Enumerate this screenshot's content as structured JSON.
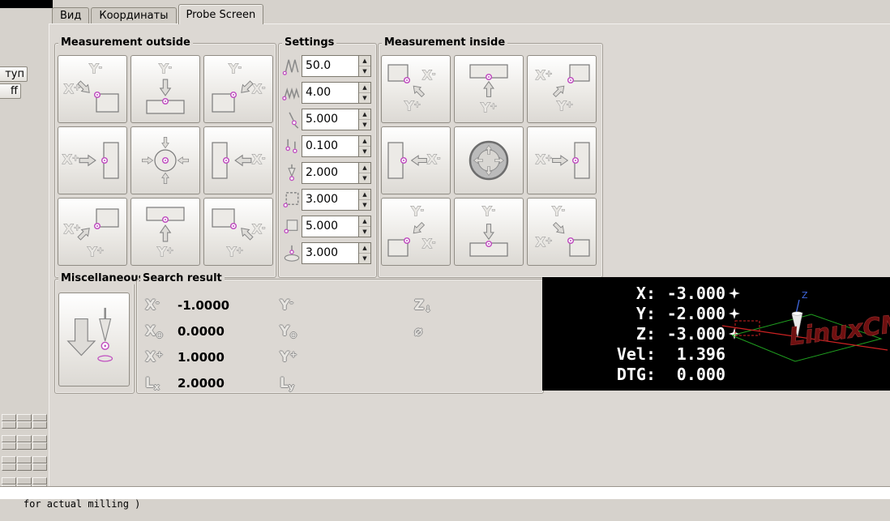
{
  "tabs": {
    "items": [
      {
        "label": "Вид"
      },
      {
        "label": "Координаты"
      },
      {
        "label": "Probe Screen"
      }
    ],
    "active_index": 2
  },
  "sidebar": {
    "top_button": "туп",
    "off_button": "ff"
  },
  "outside": {
    "title": "Measurement outside",
    "buttons": [
      {
        "icon": "out-corner-se",
        "labels": {
          "top": "Y-",
          "left": "X+"
        }
      },
      {
        "icon": "out-edge-s",
        "labels": {
          "top": "Y-"
        }
      },
      {
        "icon": "out-corner-sw",
        "labels": {
          "top": "Y-",
          "right": "X-"
        }
      },
      {
        "icon": "out-edge-e",
        "labels": {
          "left": "X+"
        }
      },
      {
        "icon": "out-center",
        "labels": {}
      },
      {
        "icon": "out-edge-w",
        "labels": {
          "right": "X-"
        }
      },
      {
        "icon": "out-corner-ne",
        "labels": {
          "left": "X+",
          "bottom": "Y+"
        }
      },
      {
        "icon": "out-edge-n",
        "labels": {
          "bottom": "Y+"
        }
      },
      {
        "icon": "out-corner-nw",
        "labels": {
          "right": "X-",
          "bottom": "Y+"
        }
      }
    ]
  },
  "settings": {
    "title": "Settings",
    "fields": [
      {
        "icon": "zigzag-fast-icon",
        "value": "50.0"
      },
      {
        "icon": "zigzag-slow-icon",
        "value": "4.00"
      },
      {
        "icon": "probe-tilt-icon",
        "value": "5.000"
      },
      {
        "icon": "probe-pair-icon",
        "value": "0.100"
      },
      {
        "icon": "probe-upright-icon",
        "value": "2.000"
      },
      {
        "icon": "square-dashed-icon",
        "value": "3.000"
      },
      {
        "icon": "square-solid-icon",
        "value": "5.000"
      },
      {
        "icon": "probe-cylinder-icon",
        "value": "3.000"
      }
    ]
  },
  "inside": {
    "title": "Measurement inside",
    "buttons": [
      {
        "icon": "in-corner-nw",
        "labels": {
          "right": "X-",
          "bottom": "Y+"
        }
      },
      {
        "icon": "in-edge-n",
        "labels": {
          "bottom": "Y+"
        }
      },
      {
        "icon": "in-corner-ne",
        "labels": {
          "left": "X+",
          "bottom": "Y+"
        }
      },
      {
        "icon": "in-edge-w",
        "labels": {
          "right": "X-"
        }
      },
      {
        "icon": "in-center",
        "labels": {}
      },
      {
        "icon": "in-edge-e",
        "labels": {
          "left": "X+"
        }
      },
      {
        "icon": "in-corner-sw",
        "labels": {
          "top": "Y-",
          "right": "X-"
        }
      },
      {
        "icon": "in-edge-s",
        "labels": {
          "top": "Y-"
        }
      },
      {
        "icon": "in-corner-se",
        "labels": {
          "top": "Y-",
          "left": "X+"
        }
      }
    ]
  },
  "misc": {
    "title": "Miscellaneous"
  },
  "search": {
    "title": "Search result",
    "columns": [
      {
        "rows": [
          {
            "glyph": "X-",
            "value": "-1.0000"
          },
          {
            "glyph": "X⊕",
            "value": "0.0000"
          },
          {
            "glyph": "X+",
            "value": "1.0000"
          },
          {
            "glyph": "Lx",
            "value": "2.0000"
          }
        ]
      },
      {
        "rows": [
          {
            "glyph": "Y-",
            "value": ""
          },
          {
            "glyph": "Y⊕",
            "value": ""
          },
          {
            "glyph": "Y+",
            "value": ""
          },
          {
            "glyph": "Ly",
            "value": ""
          }
        ]
      },
      {
        "rows": [
          {
            "glyph": "Z↓",
            "value": ""
          },
          {
            "glyph": "⌀",
            "value": ""
          }
        ]
      }
    ]
  },
  "dro": {
    "rows": [
      {
        "label": "X:",
        "value": "-3.000",
        "homed": true
      },
      {
        "label": "Y:",
        "value": "-2.000",
        "homed": true
      },
      {
        "label": "Z:",
        "value": "-3.000",
        "homed": true
      },
      {
        "label": "Vel:",
        "value": "1.396",
        "homed": false
      },
      {
        "label": "DTG:",
        "value": "0.000",
        "homed": false
      }
    ],
    "preview": {
      "logo": "LinuxCNC",
      "z_label": "Z"
    }
  },
  "statusbar": {
    "text": "for actual milling )"
  },
  "colors": {
    "probe_dot": "#c050c0",
    "dro_bg": "#000000",
    "dro_fg": "#ffffff",
    "logo_red": "#6e1010",
    "axis_x": "#cc2222",
    "axis_y": "#1f9e1f",
    "axis_z": "#4169e1",
    "window_bg": "#d6d2cc"
  }
}
